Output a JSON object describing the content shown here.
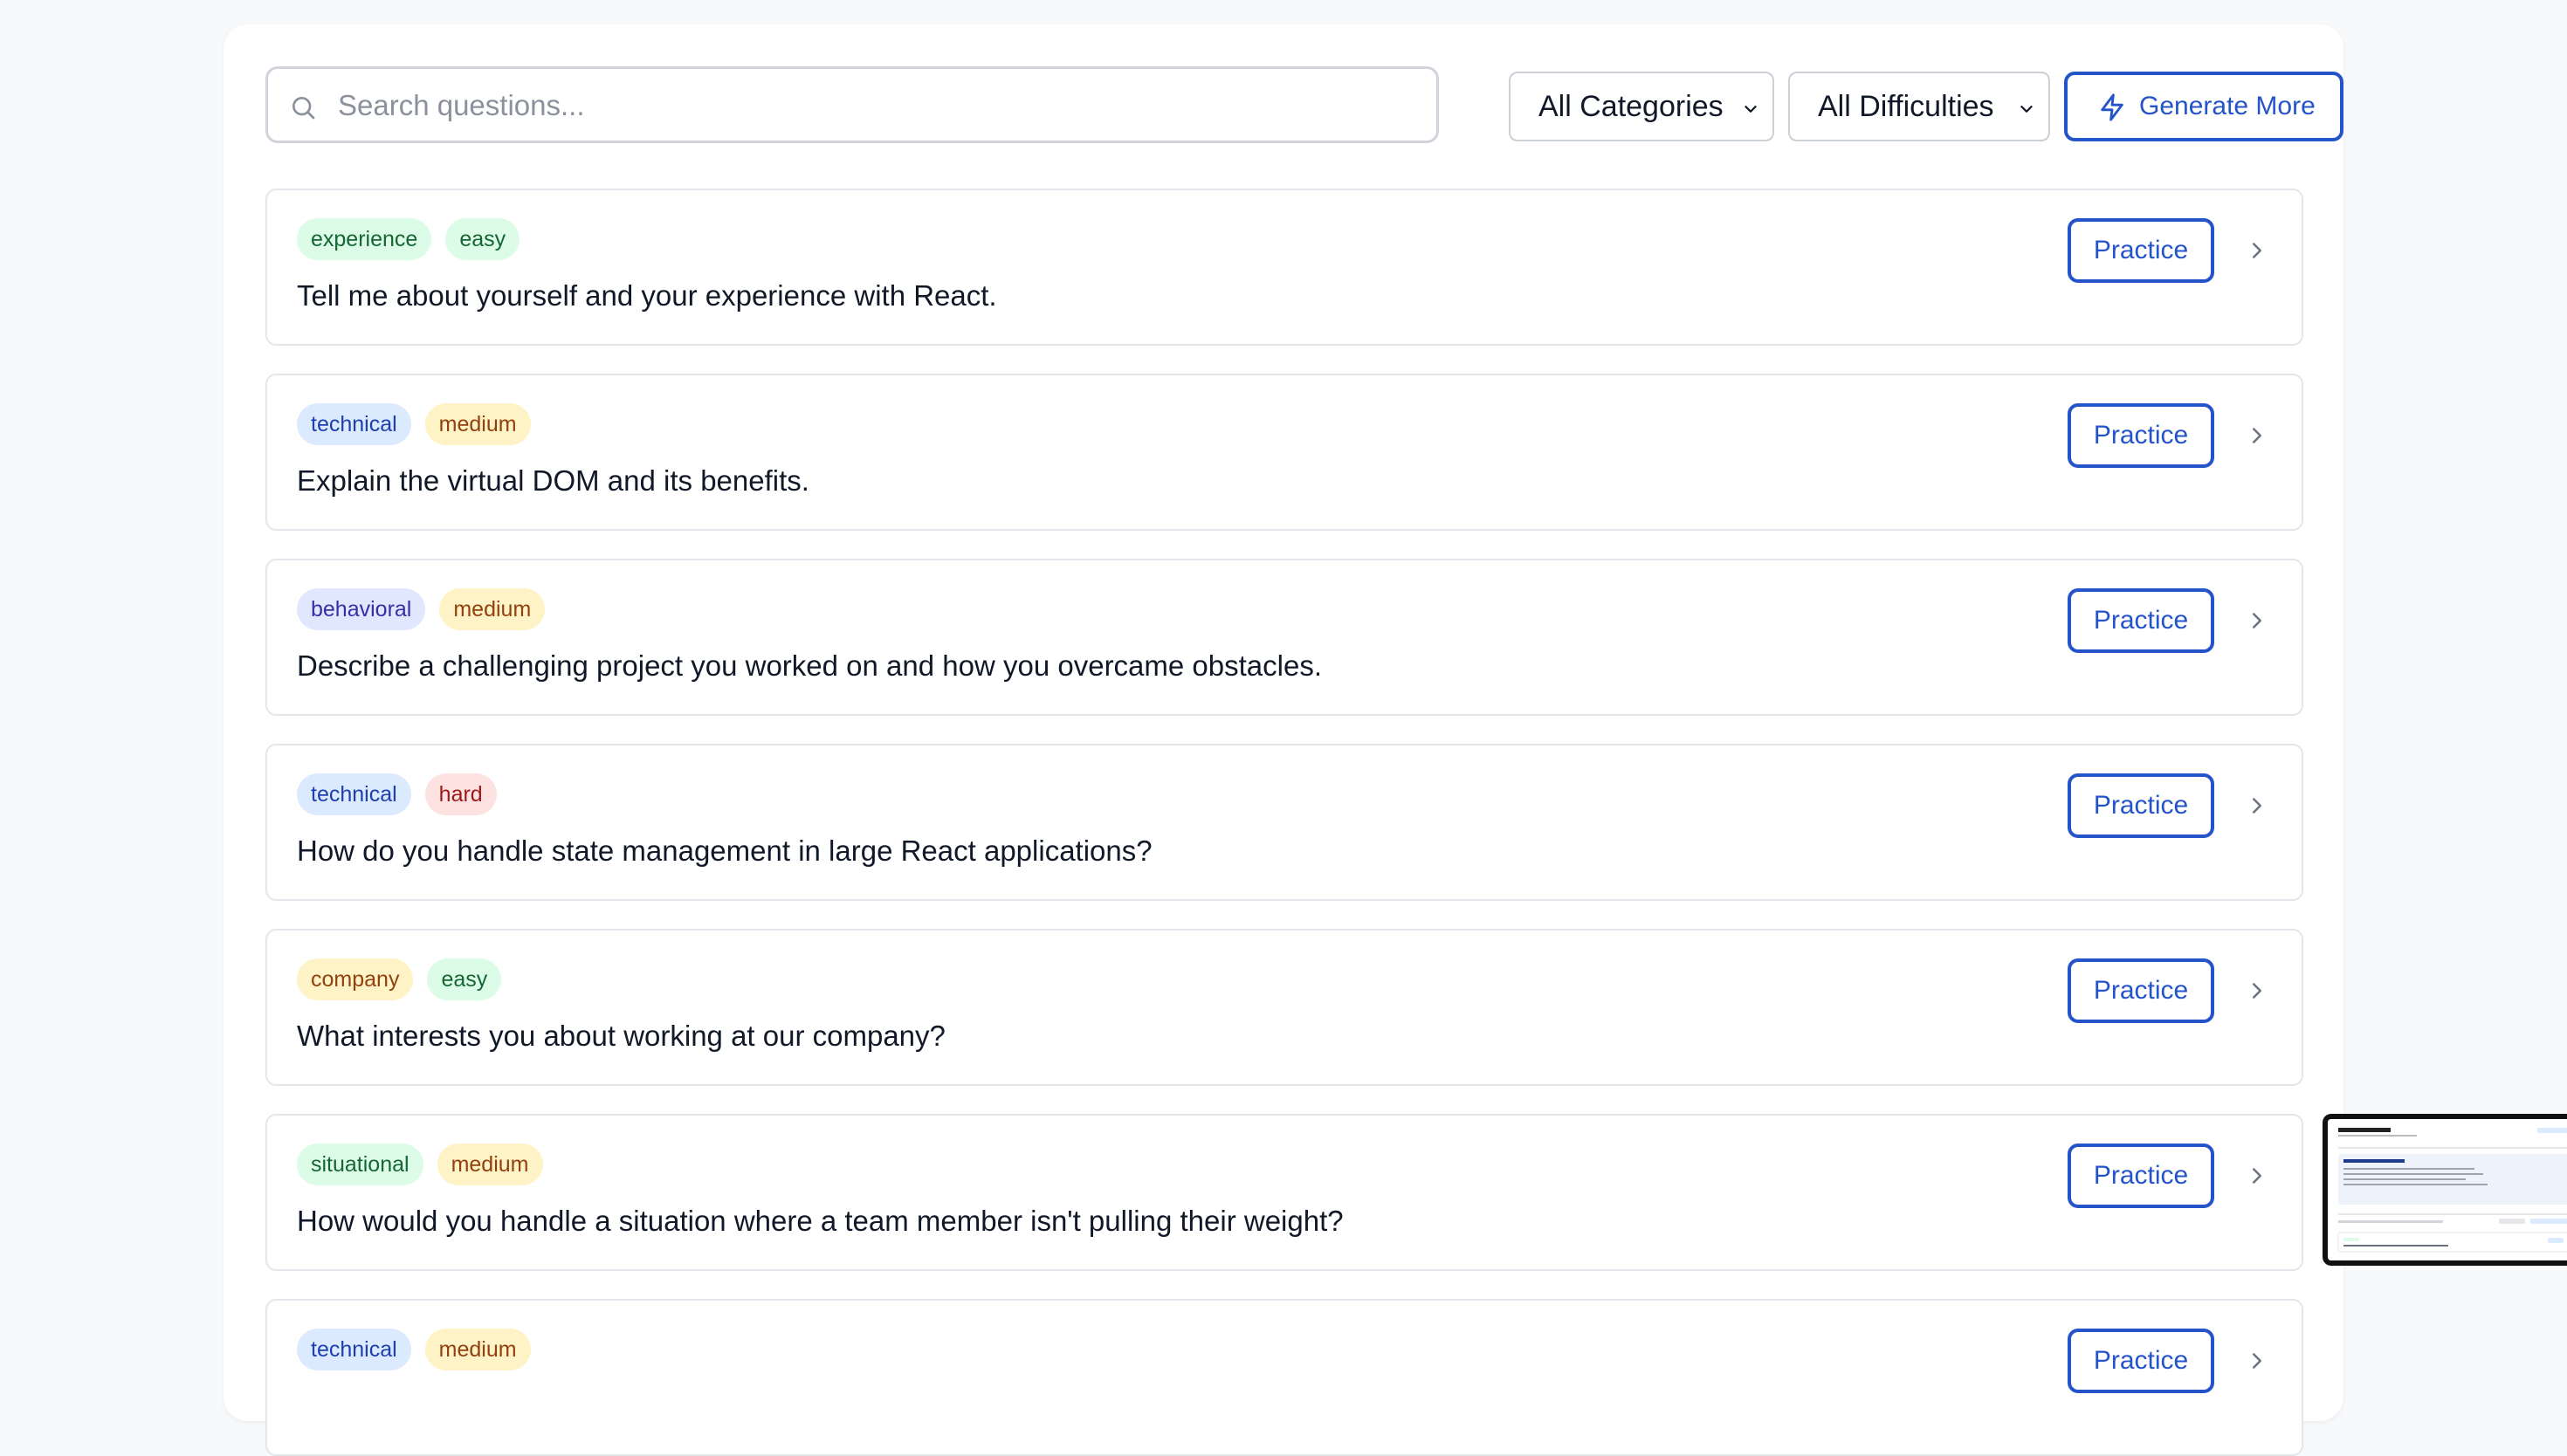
{
  "search": {
    "placeholder": "Search questions..."
  },
  "filters": {
    "category": "All Categories",
    "difficulty": "All Difficulties"
  },
  "actions": {
    "generate_more": "Generate More"
  },
  "practice_label": "Practice",
  "questions": [
    {
      "category": "experience",
      "difficulty": "easy",
      "text": "Tell me about yourself and your experience with React."
    },
    {
      "category": "technical",
      "difficulty": "medium",
      "text": "Explain the virtual DOM and its benefits."
    },
    {
      "category": "behavioral",
      "difficulty": "medium",
      "text": "Describe a challenging project you worked on and how you overcame obstacles."
    },
    {
      "category": "technical",
      "difficulty": "hard",
      "text": "How do you handle state management in large React applications?"
    },
    {
      "category": "company",
      "difficulty": "easy",
      "text": "What interests you about working at our company?"
    },
    {
      "category": "situational",
      "difficulty": "medium",
      "text": "How would you handle a situation where a team member isn't pulling their weight?"
    },
    {
      "category": "technical",
      "difficulty": "medium",
      "text": ""
    }
  ],
  "tag_colors": {
    "experience": {
      "bg": "#dcfce7",
      "fg": "#166534"
    },
    "easy": {
      "bg": "#dcfce7",
      "fg": "#166534"
    },
    "technical": {
      "bg": "#dbeafe",
      "fg": "#1e40af"
    },
    "medium": {
      "bg": "#fef3c7",
      "fg": "#92400e"
    },
    "behavioral": {
      "bg": "#e0e7ff",
      "fg": "#3730a3"
    },
    "hard": {
      "bg": "#fee2e2",
      "fg": "#991b1b"
    },
    "company": {
      "bg": "#fef3c7",
      "fg": "#92400e"
    },
    "situational": {
      "bg": "#dcfce7",
      "fg": "#166534"
    }
  },
  "accent_color": "#2553c9",
  "icons": {
    "search": "search-icon",
    "dropdown": "chevron-down-icon",
    "generate": "lightning-icon",
    "expand": "chevron-right-icon"
  }
}
